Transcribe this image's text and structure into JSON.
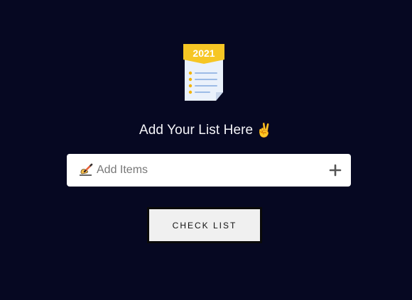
{
  "logo": {
    "year": "2021",
    "icon": "checklist-document-icon",
    "colors": {
      "banner": "#f6c624",
      "paper": "#eaf1fb",
      "fold": "#c9d6ea",
      "bullet": "#f4b400",
      "line": "#9cbbe6"
    }
  },
  "heading": {
    "text": "Add Your List Here",
    "emoji": "✌️"
  },
  "input": {
    "placeholder": "Add Items",
    "value": "",
    "leading_icon": "writing-hand-icon",
    "trailing_icon": "plus-icon"
  },
  "check_button": {
    "label": "CHECK LIST"
  },
  "colors": {
    "background": "#060822",
    "heading_text": "#f4f4f8",
    "input_bg": "#ffffff",
    "button_bg": "#f0f0f0",
    "button_border": "#0a0a0a"
  }
}
